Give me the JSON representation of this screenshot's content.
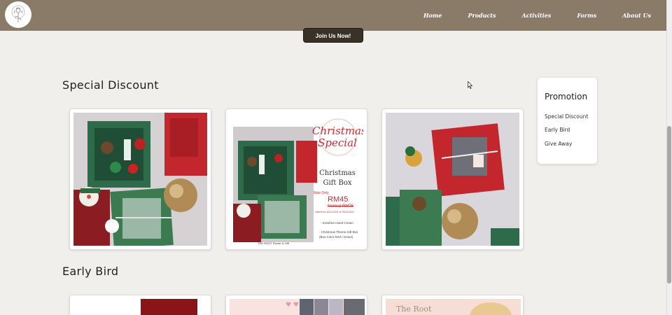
{
  "nav": {
    "items": [
      "Home",
      "Products",
      "Activities",
      "Forms",
      "About Us"
    ]
  },
  "join_button": "Join Us Now!",
  "sections": {
    "special_discount": "Special Discount",
    "early_bird": "Early Bird"
  },
  "promotion": {
    "title": "Promotion",
    "links": [
      "Special Discount",
      "Early Bird",
      "Give Away"
    ]
  },
  "xmas_card": {
    "heading_line1": "Christmas",
    "heading_line2": "Special",
    "product_line1": "Christmas",
    "product_line2": "Gift Box",
    "now_only": "Now Only",
    "price": "RM45",
    "normal_price": "Normal RM75",
    "valid": "Valid from 16/11/2021 to 03/12/2021",
    "item1": "- Innisfree Hand Cream",
    "item2": "- Christmas Theme Gift Box",
    "item3": "(Box Color Red / Green)",
    "brand": "THE ROOT Flower & Gift"
  },
  "early_card3": {
    "brand": "The Root"
  },
  "colors": {
    "navbar": "#8a7b68",
    "background": "#f1efeb",
    "button": "#3b3227",
    "accent_red": "#d3282f"
  }
}
